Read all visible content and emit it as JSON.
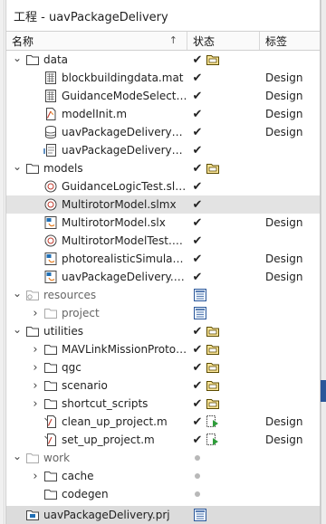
{
  "window": {
    "title": "工程 - uavPackageDelivery"
  },
  "columns": {
    "name": "名称",
    "status": "状态",
    "label": "标签"
  },
  "rows": [
    {
      "level": 0,
      "expand": "open",
      "icon": "folder-icon",
      "name": "data",
      "status": [
        "check",
        "folder-status-icon"
      ],
      "label": ""
    },
    {
      "level": 1,
      "expand": "none",
      "icon": "mat-file-icon",
      "name": "blockbuildingdata.mat",
      "status": [
        "check"
      ],
      "label": "Design"
    },
    {
      "level": 1,
      "expand": "none",
      "icon": "mat-file-icon",
      "name": "GuidanceModeSelector_...",
      "status": [
        "check"
      ],
      "label": "Design"
    },
    {
      "level": 1,
      "expand": "none",
      "icon": "m-file-icon",
      "name": "modelInit.m",
      "status": [
        "check"
      ],
      "label": "Design"
    },
    {
      "level": 1,
      "expand": "none",
      "icon": "database-icon",
      "name": "uavPackageDeliveryData...",
      "status": [
        "check"
      ],
      "label": "Design"
    },
    {
      "level": 1,
      "expand": "none",
      "icon": "requirements-icon",
      "name": "uavPackageDeliveryReqs...",
      "status": [
        "check"
      ],
      "label": ""
    },
    {
      "level": 0,
      "expand": "open",
      "icon": "folder-icon",
      "name": "models",
      "status": [
        "check",
        "folder-status-icon"
      ],
      "label": ""
    },
    {
      "level": 1,
      "expand": "none",
      "icon": "test-file-icon",
      "name": "GuidanceLogicTest.slmx",
      "status": [
        "check"
      ],
      "label": ""
    },
    {
      "level": 1,
      "expand": "none",
      "icon": "test-file-icon",
      "name": "MultirotorModel.slmx",
      "status": [
        "check"
      ],
      "label": "",
      "selected": true
    },
    {
      "level": 1,
      "expand": "none",
      "icon": "simulink-model-icon",
      "name": "MultirotorModel.slx",
      "status": [
        "check"
      ],
      "label": "Design"
    },
    {
      "level": 1,
      "expand": "none",
      "icon": "test-file-icon",
      "name": "MultirotorModelTest.slmx",
      "status": [
        "check"
      ],
      "label": ""
    },
    {
      "level": 1,
      "expand": "none",
      "icon": "simulink-model-icon",
      "name": "photorealisticSimulation...",
      "status": [
        "check"
      ],
      "label": "Design"
    },
    {
      "level": 1,
      "expand": "none",
      "icon": "simulink-model-icon",
      "name": "uavPackageDelivery.slx",
      "status": [
        "check"
      ],
      "label": "Design"
    },
    {
      "level": 0,
      "expand": "open",
      "icon": "folder-ref-icon",
      "name": "resources",
      "status": [
        "resources-status-icon"
      ],
      "label": "",
      "dim": true
    },
    {
      "level": 1,
      "expand": "closed",
      "icon": "folder-light-icon",
      "name": "project",
      "status": [
        "resources-status-icon"
      ],
      "label": "",
      "dim": true
    },
    {
      "level": 0,
      "expand": "open",
      "icon": "folder-icon",
      "name": "utilities",
      "status": [
        "check",
        "folder-status-icon"
      ],
      "label": ""
    },
    {
      "level": 1,
      "expand": "closed",
      "icon": "folder-icon",
      "name": "MAVLinkMissionProtocol...",
      "status": [
        "check",
        "folder-status-icon"
      ],
      "label": ""
    },
    {
      "level": 1,
      "expand": "closed",
      "icon": "folder-icon",
      "name": "qgc",
      "status": [
        "check",
        "folder-status-icon"
      ],
      "label": ""
    },
    {
      "level": 1,
      "expand": "closed",
      "icon": "folder-icon",
      "name": "scenario",
      "status": [
        "check",
        "folder-status-icon"
      ],
      "label": ""
    },
    {
      "level": 1,
      "expand": "closed",
      "icon": "folder-icon",
      "name": "shortcut_scripts",
      "status": [
        "check",
        "folder-status-icon"
      ],
      "label": ""
    },
    {
      "level": 1,
      "expand": "none",
      "icon": "script-file-icon",
      "name": "clean_up_project.m",
      "status": [
        "check",
        "run-status-icon"
      ],
      "label": "Design"
    },
    {
      "level": 1,
      "expand": "none",
      "icon": "script-file-icon",
      "name": "set_up_project.m",
      "status": [
        "check",
        "run-status-icon"
      ],
      "label": "Design"
    },
    {
      "level": 0,
      "expand": "open",
      "icon": "folder-light-icon",
      "name": "work",
      "status": [
        "dot"
      ],
      "label": "",
      "dim": true
    },
    {
      "level": 1,
      "expand": "closed",
      "icon": "folder-icon",
      "name": "cache",
      "status": [
        "dot"
      ],
      "label": ""
    },
    {
      "level": 1,
      "expand": "none",
      "icon": "folder-icon",
      "name": "codegen",
      "status": [
        "dot"
      ],
      "label": ""
    }
  ],
  "footer_row": {
    "icon": "project-file-icon",
    "name": "uavPackageDelivery.prj",
    "status": [
      "resources-status-icon"
    ]
  }
}
